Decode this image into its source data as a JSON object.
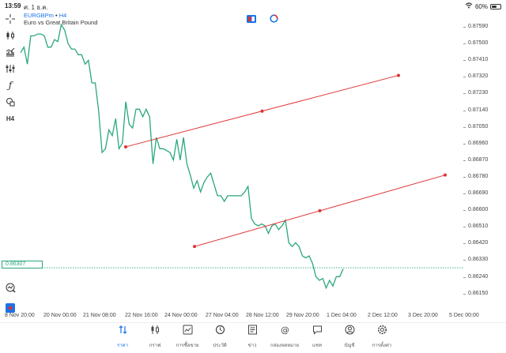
{
  "status_bar": {
    "time": "13:59",
    "date": "ศ. 1 ธ.ค.",
    "battery": "60%",
    "battery_level": 0.6
  },
  "symbol": {
    "name": "EURGBPm",
    "timeframe": "H4",
    "description": "Euro vs Great Britain Pound"
  },
  "left_toolbar": {
    "timeframe_label": "H4",
    "icons": [
      "crosshair-icon",
      "candle-chart-icon",
      "indicator-icon",
      "objects-icon",
      "function-icon",
      "shapes-icon"
    ]
  },
  "price_axis": {
    "labels": [
      "0.87590",
      "0.87500",
      "0.87410",
      "0.87320",
      "0.87230",
      "0.87140",
      "0.87050",
      "0.86960",
      "0.86870",
      "0.86780",
      "0.86690",
      "0.86600",
      "0.86510",
      "0.86420",
      "0.86330",
      "0.86240",
      "0.86150"
    ],
    "current_price": "0.86307"
  },
  "time_axis": {
    "labels": [
      "8 Nov 20:00",
      "20 Nov 00:00",
      "21 Nov 08:00",
      "22 Nov 16:00",
      "24 Nov 00:00",
      "27 Nov 04:00",
      "28 Nov 12:00",
      "29 Nov 20:00",
      "1 Dec 04:00",
      "2 Dec 12:00",
      "3 Dec 20:00",
      "5 Dec 00:00"
    ]
  },
  "chart_data": {
    "type": "line",
    "series": [
      {
        "values": [
          0.8745,
          0.8748,
          0.8739,
          0.8754,
          0.8754,
          0.8755,
          0.8755,
          0.8754,
          0.8748,
          0.8748,
          0.8752,
          0.8751,
          0.876,
          0.8757,
          0.875,
          0.8747,
          0.8747,
          0.8744,
          0.8744,
          0.8739,
          0.8741,
          0.8729,
          0.8729,
          0.8714,
          0.8692,
          0.8694,
          0.8704,
          0.8701,
          0.871,
          0.8694,
          0.8697,
          0.8719,
          0.8707,
          0.8705,
          0.8715,
          0.8715,
          0.8711,
          0.8715,
          0.8711,
          0.8686,
          0.87,
          0.8694,
          0.8694,
          0.8693,
          0.8692,
          0.8688,
          0.8699,
          0.8688,
          0.87,
          0.8686,
          0.868,
          0.8673,
          0.8677,
          0.8671,
          0.8676,
          0.8679,
          0.8681,
          0.8675,
          0.8669,
          0.8669,
          0.8666,
          0.8669,
          0.8669,
          0.8669,
          0.8669,
          0.8669,
          0.8671,
          0.8674,
          0.8657,
          0.8654,
          0.8653,
          0.8654,
          0.8653,
          0.8649,
          0.8653,
          0.8654,
          0.8651,
          0.8653,
          0.8656,
          0.8644,
          0.8642,
          0.8644,
          0.8642,
          0.8637,
          0.8636,
          0.8637,
          0.8633,
          0.8626,
          0.8624,
          0.8625,
          0.862,
          0.8624,
          0.8621,
          0.8626,
          0.8626,
          0.863
        ]
      }
    ],
    "trendlines": [
      {
        "start_value": 0.8695,
        "end_value": 0.8733
      },
      {
        "start_value": 0.8642,
        "end_value": 0.868
      }
    ],
    "current_price": 0.86307,
    "ylim": [
      0.8611,
      0.8763
    ],
    "grid": false
  },
  "bottom_nav": [
    {
      "key": "quotes",
      "label": "ราคา",
      "icon": "quotes-icon",
      "active": true
    },
    {
      "key": "chart",
      "label": "กราฟ",
      "icon": "chart-icon",
      "active": false
    },
    {
      "key": "trade",
      "label": "การซื้อขาย",
      "icon": "trade-icon",
      "active": false
    },
    {
      "key": "history",
      "label": "ประวัติ",
      "icon": "history-icon",
      "active": false
    },
    {
      "key": "news",
      "label": "ข่าว",
      "icon": "news-icon",
      "active": false
    },
    {
      "key": "mailbox",
      "label": "กล่องจดหมาย",
      "icon": "mail-icon",
      "active": false
    },
    {
      "key": "chat",
      "label": "แชท",
      "icon": "chat-icon",
      "active": false
    },
    {
      "key": "account",
      "label": "บัญชี",
      "icon": "account-icon",
      "active": false
    },
    {
      "key": "settings",
      "label": "การตั้งค่า",
      "icon": "settings-icon",
      "active": false
    }
  ],
  "colors": {
    "price_line": "#2aa87a",
    "trendline": "#e03131",
    "accent": "#1a73e8"
  }
}
